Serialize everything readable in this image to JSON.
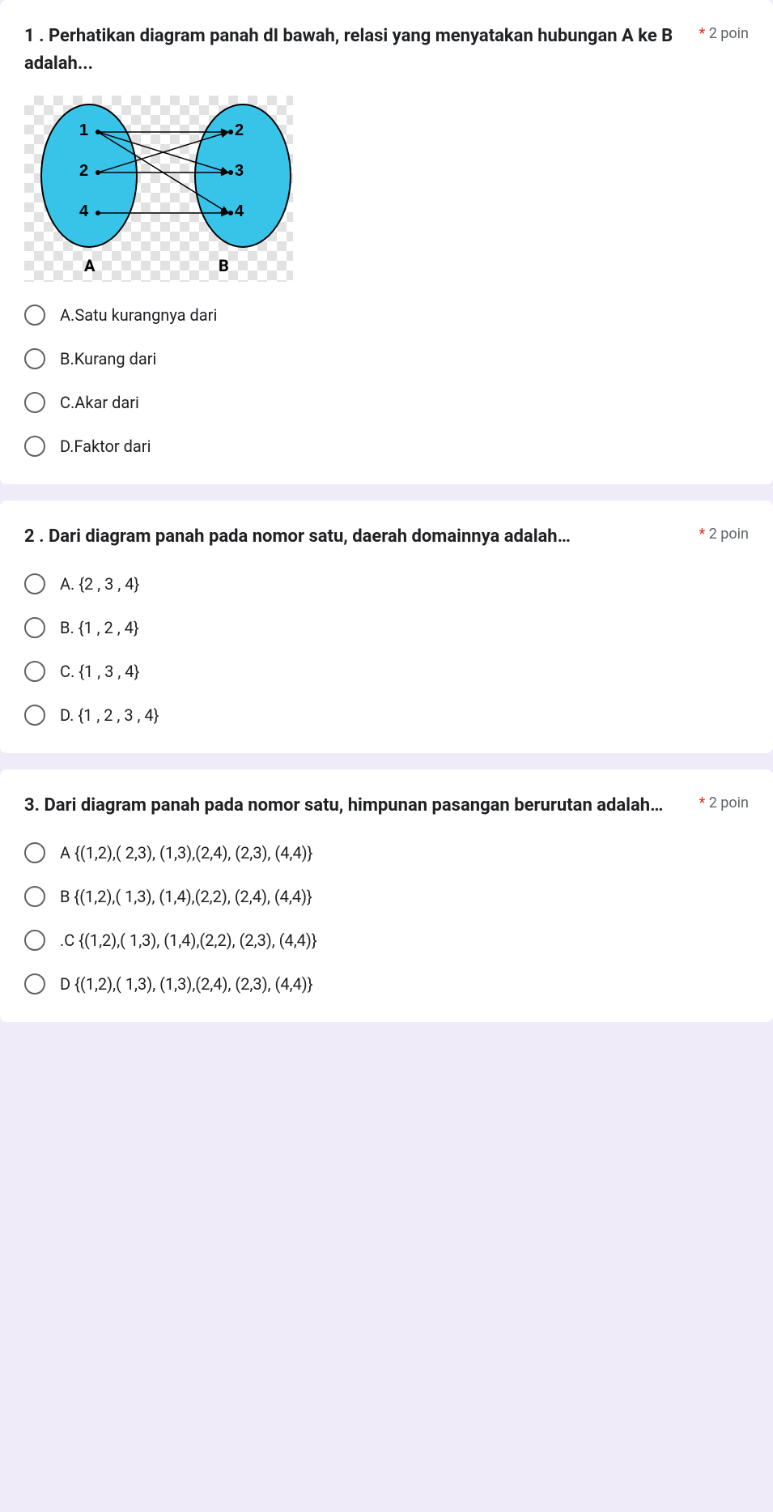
{
  "q1": {
    "title": "1 . Perhatikan diagram panah dI bawah, relasi yang menyatakan hubungan A ke B adalah...",
    "points": "2 poin",
    "options": {
      "a": "A.Satu kurangnya dari",
      "b": "B.Kurang dari",
      "c": "C.Akar dari",
      "d": "D.Faktor dari"
    },
    "diagram": {
      "setA": [
        "1",
        "2",
        "4"
      ],
      "setB": [
        "2",
        "3",
        "4"
      ],
      "labelA": "A",
      "labelB": "B"
    }
  },
  "q2": {
    "title": "2 . Dari diagram panah pada nomor satu, daerah domainnya adalah…",
    "points": "2 poin",
    "options": {
      "a": "A.   {2 , 3 , 4}",
      "b": "B.   {1 , 2 , 4}",
      "c": "C.   {1 , 3 , 4}",
      "d": "D.   {1 , 2 , 3 , 4}"
    }
  },
  "q3": {
    "title": "3. Dari diagram panah pada nomor satu, himpunan pasangan berurutan adalah…",
    "points": "2 poin",
    "options": {
      "a": "A   {(1,2),( 2,3), (1,3),(2,4), (2,3), (4,4)}",
      "b": "B   {(1,2),( 1,3), (1,4),(2,2), (2,4), (4,4)}",
      "c": ".C   {(1,2),( 1,3), (1,4),(2,2), (2,3), (4,4)}",
      "d": "D   {(1,2),( 1,3), (1,3),(2,4), (2,3), (4,4)}"
    }
  },
  "chart_data": {
    "type": "mapping-diagram",
    "setA": [
      1,
      2,
      4
    ],
    "setB": [
      2,
      3,
      4
    ],
    "arrows": [
      [
        1,
        2
      ],
      [
        1,
        3
      ],
      [
        1,
        4
      ],
      [
        2,
        2
      ],
      [
        2,
        3
      ],
      [
        4,
        4
      ]
    ],
    "labelA": "A",
    "labelB": "B"
  }
}
